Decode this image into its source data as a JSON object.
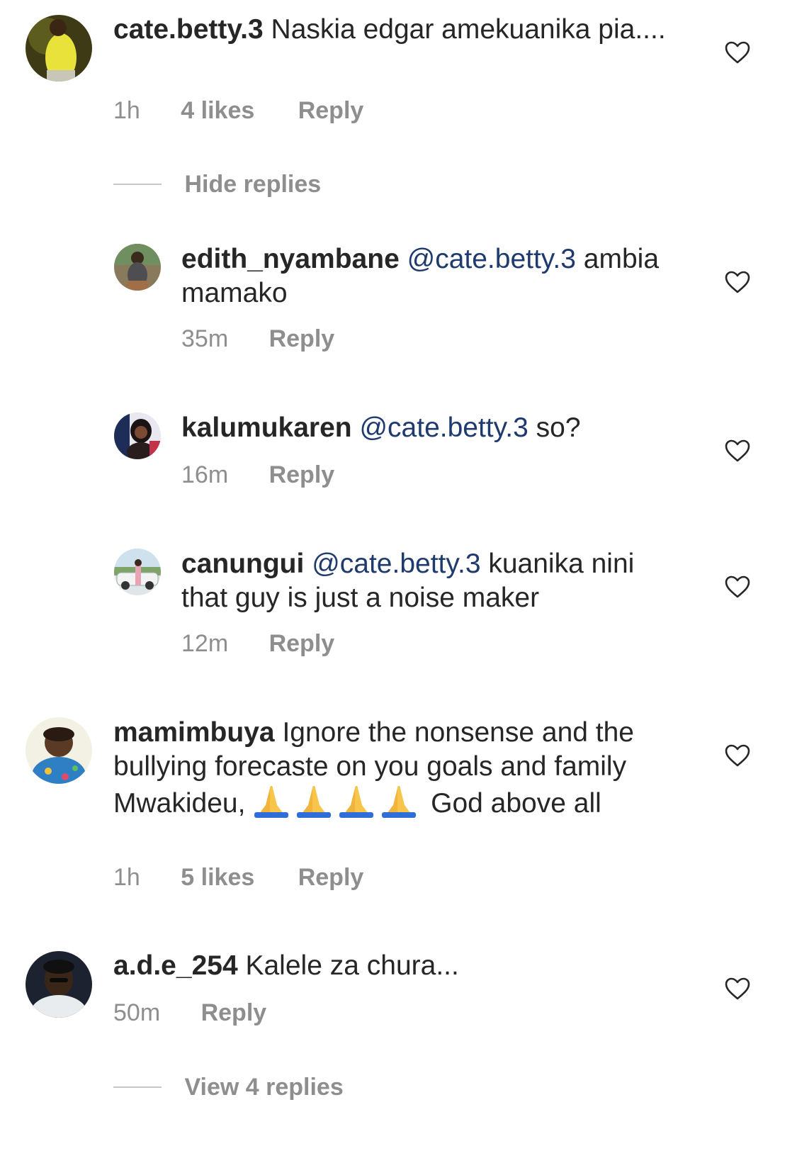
{
  "comments": [
    {
      "username": "cate.betty.3",
      "text": "Naskia edgar amekuanika pia....",
      "time": "1h",
      "likes": "4 likes",
      "reply": "Reply"
    },
    {
      "username": "mamimbuya",
      "text_part1": "Ignore the nonsense and the bullying forecaste on you goals and family Mwakideu,",
      "text_part2": "God above all",
      "emoji_count": 4,
      "time": "1h",
      "likes": "5 likes",
      "reply": "Reply"
    },
    {
      "username": "a.d.e_254",
      "text": "Kalele za chura...",
      "time": "50m",
      "reply": "Reply"
    }
  ],
  "replies": [
    {
      "username": "edith_nyambane",
      "mention": "@cate.betty.3",
      "text": "ambia mamako",
      "time": "35m",
      "reply": "Reply"
    },
    {
      "username": "kalumukaren",
      "mention": "@cate.betty.3",
      "text": "so?",
      "time": "16m",
      "reply": "Reply"
    },
    {
      "username": "canungui",
      "mention": "@cate.betty.3",
      "text": "kuanika nini that guy is just a noise maker",
      "time": "12m",
      "reply": "Reply"
    }
  ],
  "thread_controls": {
    "hide_replies": "Hide replies",
    "view_replies": "View 4 replies"
  },
  "colors": {
    "text": "#262626",
    "meta": "#8e8e8e",
    "mention": "#1f3a6e",
    "divider": "#c7c7c7"
  },
  "icons": {
    "like": "heart-outline-icon",
    "emoji": "folded-hands-emoji"
  }
}
